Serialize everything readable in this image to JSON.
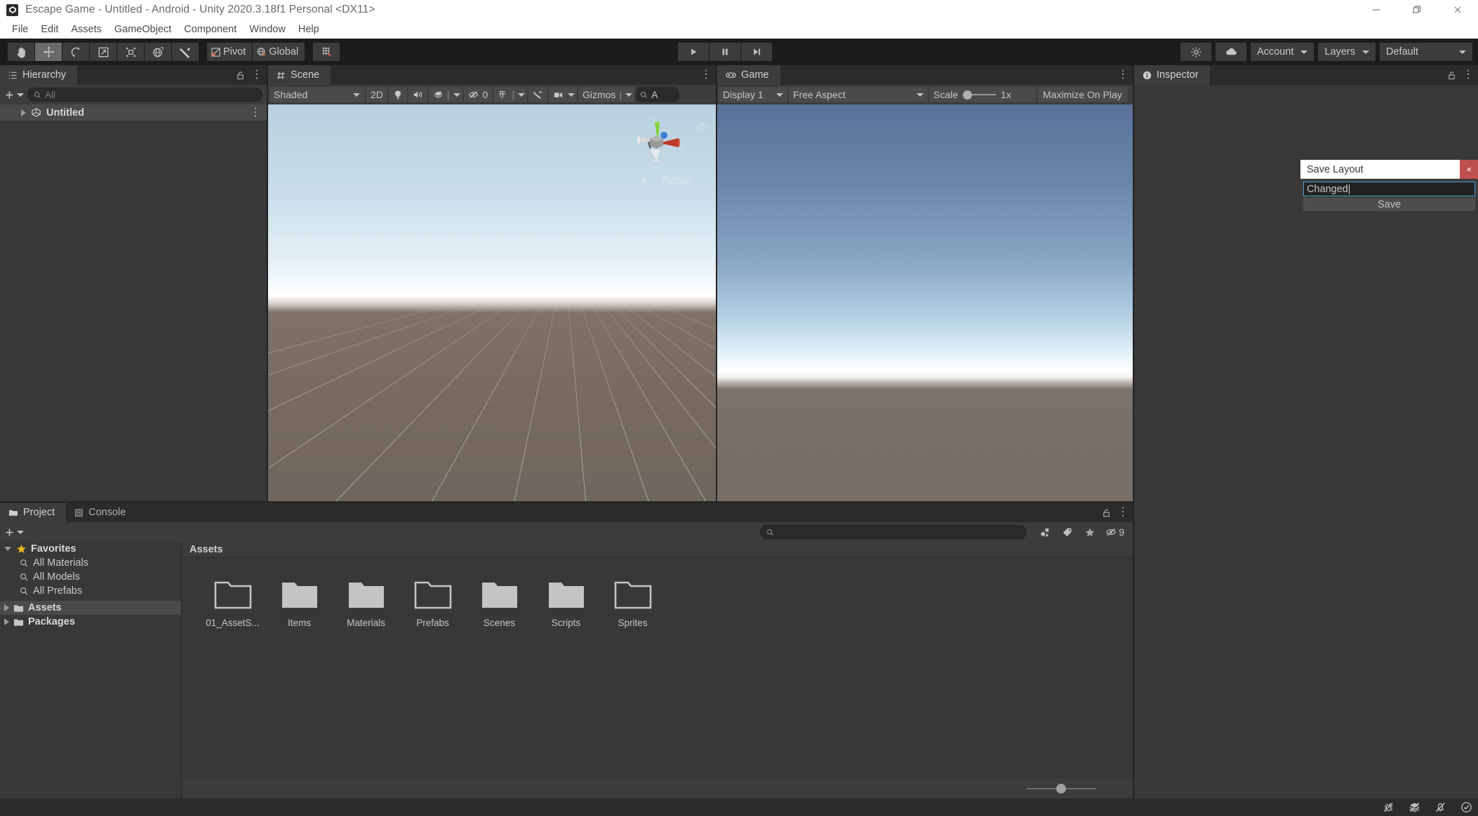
{
  "window": {
    "title": "Escape Game - Untitled - Android - Unity 2020.3.18f1 Personal <DX11>",
    "app_icon": "unity-icon",
    "minimize": "minimize-icon",
    "restore": "restore-icon",
    "close": "close-icon"
  },
  "menubar": {
    "items": [
      "File",
      "Edit",
      "Assets",
      "GameObject",
      "Component",
      "Window",
      "Help"
    ]
  },
  "toolbar": {
    "tools": [
      {
        "name": "hand-tool",
        "icon": "hand-icon",
        "active": false
      },
      {
        "name": "move-tool",
        "icon": "move-icon",
        "active": true
      },
      {
        "name": "rotate-tool",
        "icon": "rotate-icon",
        "active": false
      },
      {
        "name": "scale-tool",
        "icon": "scale-icon",
        "active": false
      },
      {
        "name": "rect-tool",
        "icon": "rect-icon",
        "active": false
      },
      {
        "name": "transform-tool",
        "icon": "transform-icon",
        "active": false
      },
      {
        "name": "custom-tool",
        "icon": "wrench-icon",
        "active": false
      }
    ],
    "pivot_label": "Pivot",
    "global_label": "Global",
    "grid_snap_icon": "grid-snap-icon",
    "play_label": "play-icon",
    "pause_label": "pause-icon",
    "step_label": "step-icon",
    "collab_icon": "collab-icon",
    "cloud_icon": "cloud-icon",
    "account_label": "Account",
    "layers_label": "Layers",
    "layout_label": "Default"
  },
  "hierarchy": {
    "tab": "Hierarchy",
    "tab_icon": "hierarchy-icon",
    "lock_icon": "lock-icon",
    "menu_icon": "kebab-icon",
    "add_label": "+",
    "search_placeholder": "All",
    "search_value": "",
    "rows": [
      {
        "label": "Untitled",
        "icon": "scene-icon",
        "selected": true
      }
    ]
  },
  "scene": {
    "tab": "Scene",
    "tab_icon": "scene-grid-icon",
    "menu_icon": "kebab-icon",
    "shading_mode": "Shaded",
    "mode_2d": "2D",
    "lighting_icon": "lightbulb-icon",
    "audio_icon": "audio-icon",
    "fx_icon": "effects-icon",
    "hidden_count": "0",
    "grid_icon": "grid-icon",
    "tools_icon": "wrench-icon",
    "camera_icon": "camera-icon",
    "gizmos_label": "Gizmos",
    "search_icon": "search-icon",
    "search_value": "A",
    "perspective_label": "Persp",
    "gizmo_axes": [
      "x",
      "y",
      "z"
    ],
    "lock_icon": "lock-icon"
  },
  "game": {
    "tab": "Game",
    "tab_icon": "gamepad-icon",
    "menu_icon": "kebab-icon",
    "display_label": "Display 1",
    "aspect_label": "Free Aspect",
    "scale_label": "Scale",
    "scale_value": "1x",
    "maximize_label": "Maximize On Play"
  },
  "inspector": {
    "tab": "Inspector",
    "tab_icon": "info-icon",
    "lock_icon": "lock-icon",
    "menu_icon": "kebab-icon"
  },
  "project": {
    "tabs": [
      {
        "label": "Project",
        "icon": "folder-icon",
        "active": true
      },
      {
        "label": "Console",
        "icon": "console-icon",
        "active": false
      }
    ],
    "lock_icon": "lock-icon",
    "menu_icon": "kebab-icon",
    "add_label": "+",
    "search_value": "",
    "filter_type_icon": "type-filter-icon",
    "filter_label_icon": "label-filter-icon",
    "filter_favorite_icon": "star-icon",
    "hidden_count": "9",
    "tree": [
      {
        "label": "Favorites",
        "icon": "star-icon",
        "indent": 0,
        "expanded": true,
        "bold": true,
        "selected": false
      },
      {
        "label": "All Materials",
        "icon": "search-icon",
        "indent": 1,
        "bold": false,
        "selected": false
      },
      {
        "label": "All Models",
        "icon": "search-icon",
        "indent": 1,
        "bold": false,
        "selected": false
      },
      {
        "label": "All Prefabs",
        "icon": "search-icon",
        "indent": 1,
        "bold": false,
        "selected": false
      },
      {
        "label": "Assets",
        "icon": "folder-icon",
        "indent": 0,
        "collapsed": true,
        "bold": true,
        "selected": true
      },
      {
        "label": "Packages",
        "icon": "folder-icon",
        "indent": 0,
        "collapsed": true,
        "bold": true,
        "selected": false
      }
    ],
    "breadcrumb": "Assets",
    "assets": [
      {
        "label": "01_AssetS...",
        "icon": "folder-empty-icon"
      },
      {
        "label": "Items",
        "icon": "folder-full-icon"
      },
      {
        "label": "Materials",
        "icon": "folder-full-icon"
      },
      {
        "label": "Prefabs",
        "icon": "folder-empty-icon"
      },
      {
        "label": "Scenes",
        "icon": "folder-full-icon"
      },
      {
        "label": "Scripts",
        "icon": "folder-full-icon"
      },
      {
        "label": "Sprites",
        "icon": "folder-empty-icon"
      }
    ],
    "zoom_slider_icon": "zoom-slider"
  },
  "save_layout_dialog": {
    "title": "Save Layout",
    "close_label": "×",
    "input_value": "Changed",
    "save_label": "Save"
  },
  "statusbar": {
    "icons": [
      "bug-off-icon",
      "layers-icon",
      "bell-off-icon",
      "check-circle-icon"
    ]
  },
  "colors": {
    "accent_blue": "#4e9bd6",
    "close_red": "#c0504d",
    "favorite_yellow": "#e8b81a",
    "panel_bg": "#383838",
    "toolbar_bg": "#3c3c3c",
    "dark_bg": "#1c1c1c"
  }
}
